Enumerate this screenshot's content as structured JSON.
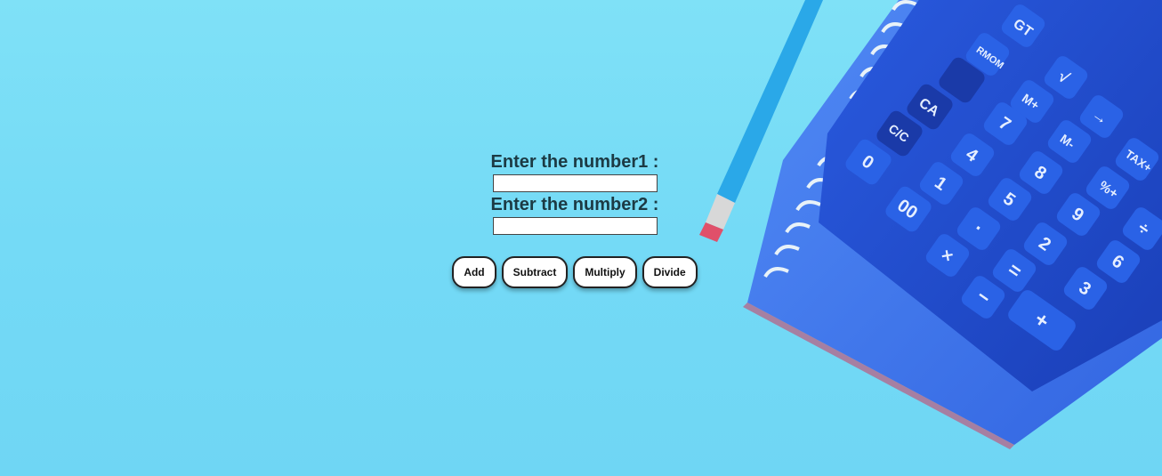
{
  "form": {
    "number1_label": "Enter the number1 :",
    "number1_value": "",
    "number2_label": "Enter the number2 :",
    "number2_value": ""
  },
  "buttons": {
    "add": "Add",
    "subtract": "Subtract",
    "multiply": "Multiply",
    "divide": "Divide"
  },
  "background": {
    "keys_row1": [
      "GT"
    ],
    "keys_row2": [
      "RMOM",
      "√"
    ],
    "keys_row3": [
      "CA",
      "M+",
      "→"
    ],
    "keys_row4": [
      "C/C",
      "7",
      "M-",
      "TAX+"
    ],
    "keys_row5": [
      "0",
      "4",
      "8",
      "%+"
    ],
    "keys_row6": [
      "00",
      "1",
      "5",
      "9",
      "÷"
    ],
    "keys_row7": [
      "·",
      "2",
      "6",
      "×"
    ],
    "keys_row8": [
      "=",
      "3",
      "−"
    ],
    "keys_row9": [
      "+"
    ],
    "colors": {
      "background": "#77dcf6",
      "calculator": "#1e4fd0",
      "keys": "#2a62e6",
      "notebook": "#3a6ff0",
      "pencil": "#2aa8e8"
    }
  }
}
